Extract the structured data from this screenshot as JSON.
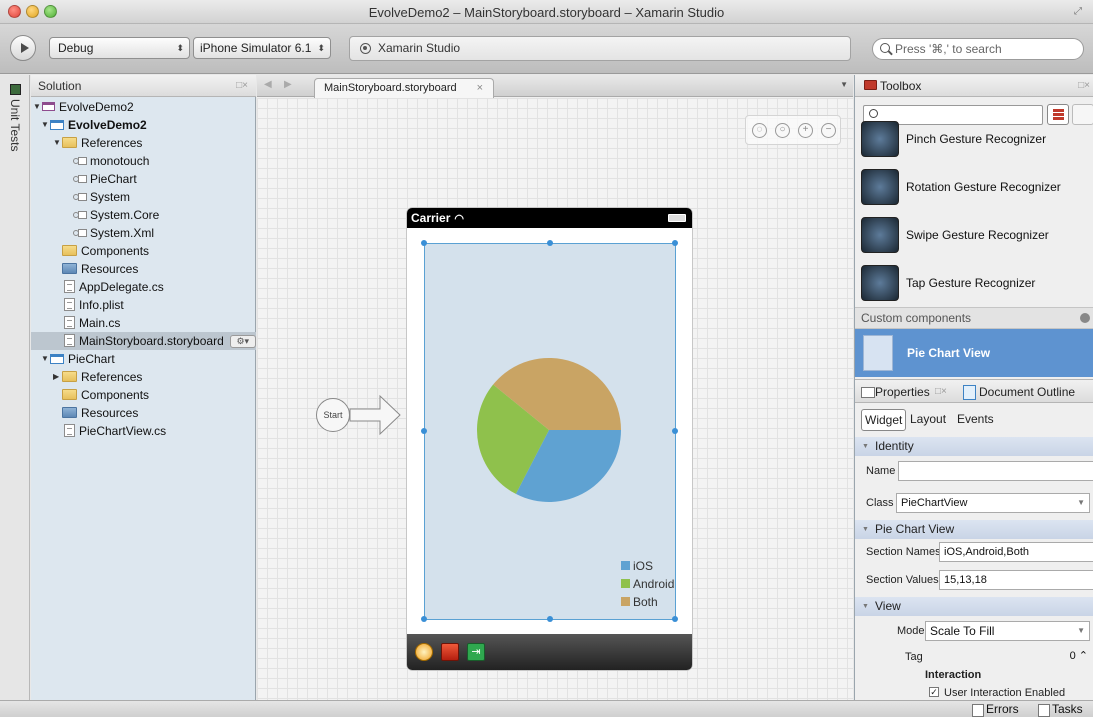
{
  "window": {
    "title": "EvolveDemo2 – MainStoryboard.storyboard – Xamarin Studio"
  },
  "toolbar": {
    "configuration": "Debug",
    "device": "iPhone Simulator 6.1",
    "status": "Xamarin Studio",
    "search_placeholder": "Press '⌘,' to search"
  },
  "unit_tests": {
    "label": "Unit Tests"
  },
  "solution": {
    "title": "Solution",
    "pad_controls": "□×",
    "items": [
      {
        "label": "EvolveDemo2",
        "icon": "solution-icon"
      },
      {
        "label": "EvolveDemo2",
        "icon": "project-icon"
      },
      {
        "label": "References",
        "icon": "folder-icon"
      },
      {
        "label": "monotouch",
        "icon": "reference-icon"
      },
      {
        "label": "PieChart",
        "icon": "reference-icon"
      },
      {
        "label": "System",
        "icon": "reference-icon"
      },
      {
        "label": "System.Core",
        "icon": "reference-icon"
      },
      {
        "label": "System.Xml",
        "icon": "reference-icon"
      },
      {
        "label": "Components",
        "icon": "folder-icon"
      },
      {
        "label": "Resources",
        "icon": "folder-blue-icon"
      },
      {
        "label": "AppDelegate.cs",
        "icon": "file-icon"
      },
      {
        "label": "Info.plist",
        "icon": "file-icon"
      },
      {
        "label": "Main.cs",
        "icon": "file-icon"
      },
      {
        "label": "MainStoryboard.storyboard",
        "icon": "storyboard-file-icon"
      },
      {
        "label": "PieChart",
        "icon": "project-icon"
      },
      {
        "label": "References",
        "icon": "folder-icon"
      },
      {
        "label": "Components",
        "icon": "folder-icon"
      },
      {
        "label": "Resources",
        "icon": "folder-blue-icon"
      },
      {
        "label": "PieChartView.cs",
        "icon": "file-icon"
      }
    ]
  },
  "editor": {
    "tab_label": "MainStoryboard.storyboard",
    "tab_close": "×",
    "start_label": "Start",
    "status_carrier": "Carrier"
  },
  "pie": {
    "legend": [
      {
        "name": "iOS",
        "value": 15,
        "color": "#5fa2d2"
      },
      {
        "name": "Android",
        "value": 13,
        "color": "#8fc14c"
      },
      {
        "name": "Both",
        "value": 18,
        "color": "#c9a464"
      }
    ]
  },
  "toolbox": {
    "title": "Toolbox",
    "items": [
      "Pinch Gesture Recognizer",
      "Rotation Gesture Recognizer",
      "Swipe Gesture Recognizer",
      "Tap Gesture Recognizer"
    ],
    "custom_header": "Custom components",
    "custom_item": "Pie Chart View"
  },
  "properties": {
    "tab": "Properties",
    "tab_controls": "□×",
    "outline_tab": "Document Outline",
    "subtabs": {
      "widget": "Widget",
      "layout": "Layout",
      "events": "Events"
    },
    "identity_header": "Identity",
    "name_label": "Name",
    "name_value": "",
    "class_label": "Class",
    "class_value": "PieChartView",
    "pie_header": "Pie Chart View",
    "section_names_label": "Section Names",
    "section_names_value": "iOS,Android,Both",
    "section_values_label": "Section Values",
    "section_values_value": "15,13,18",
    "view_header": "View",
    "mode_label": "Mode",
    "mode_value": "Scale To Fill",
    "tag_label": "Tag",
    "tag_value": "0 ⌃",
    "interaction_label": "Interaction",
    "user_interaction": "User Interaction Enabled"
  },
  "bottom": {
    "errors": "Errors",
    "tasks": "Tasks"
  }
}
